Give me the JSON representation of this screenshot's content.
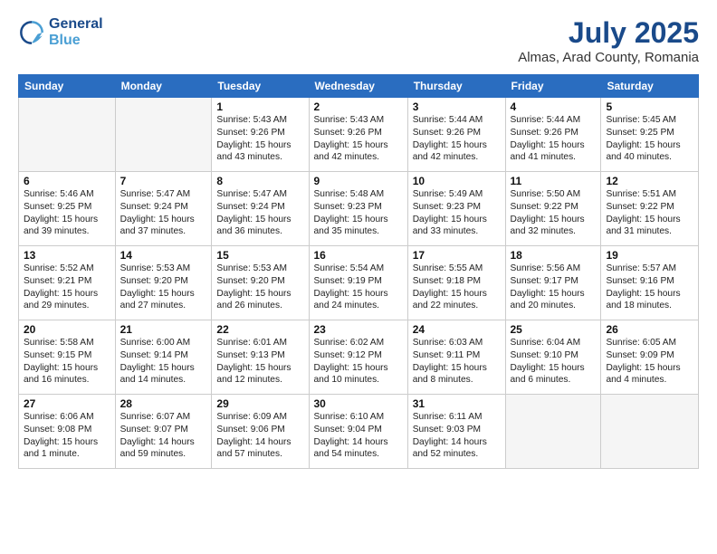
{
  "logo": {
    "line1": "General",
    "line2": "Blue"
  },
  "title": "July 2025",
  "subtitle": "Almas, Arad County, Romania",
  "days_header": [
    "Sunday",
    "Monday",
    "Tuesday",
    "Wednesday",
    "Thursday",
    "Friday",
    "Saturday"
  ],
  "weeks": [
    [
      {
        "day": "",
        "info": ""
      },
      {
        "day": "",
        "info": ""
      },
      {
        "day": "1",
        "info": "Sunrise: 5:43 AM\nSunset: 9:26 PM\nDaylight: 15 hours\nand 43 minutes."
      },
      {
        "day": "2",
        "info": "Sunrise: 5:43 AM\nSunset: 9:26 PM\nDaylight: 15 hours\nand 42 minutes."
      },
      {
        "day": "3",
        "info": "Sunrise: 5:44 AM\nSunset: 9:26 PM\nDaylight: 15 hours\nand 42 minutes."
      },
      {
        "day": "4",
        "info": "Sunrise: 5:44 AM\nSunset: 9:26 PM\nDaylight: 15 hours\nand 41 minutes."
      },
      {
        "day": "5",
        "info": "Sunrise: 5:45 AM\nSunset: 9:25 PM\nDaylight: 15 hours\nand 40 minutes."
      }
    ],
    [
      {
        "day": "6",
        "info": "Sunrise: 5:46 AM\nSunset: 9:25 PM\nDaylight: 15 hours\nand 39 minutes."
      },
      {
        "day": "7",
        "info": "Sunrise: 5:47 AM\nSunset: 9:24 PM\nDaylight: 15 hours\nand 37 minutes."
      },
      {
        "day": "8",
        "info": "Sunrise: 5:47 AM\nSunset: 9:24 PM\nDaylight: 15 hours\nand 36 minutes."
      },
      {
        "day": "9",
        "info": "Sunrise: 5:48 AM\nSunset: 9:23 PM\nDaylight: 15 hours\nand 35 minutes."
      },
      {
        "day": "10",
        "info": "Sunrise: 5:49 AM\nSunset: 9:23 PM\nDaylight: 15 hours\nand 33 minutes."
      },
      {
        "day": "11",
        "info": "Sunrise: 5:50 AM\nSunset: 9:22 PM\nDaylight: 15 hours\nand 32 minutes."
      },
      {
        "day": "12",
        "info": "Sunrise: 5:51 AM\nSunset: 9:22 PM\nDaylight: 15 hours\nand 31 minutes."
      }
    ],
    [
      {
        "day": "13",
        "info": "Sunrise: 5:52 AM\nSunset: 9:21 PM\nDaylight: 15 hours\nand 29 minutes."
      },
      {
        "day": "14",
        "info": "Sunrise: 5:53 AM\nSunset: 9:20 PM\nDaylight: 15 hours\nand 27 minutes."
      },
      {
        "day": "15",
        "info": "Sunrise: 5:53 AM\nSunset: 9:20 PM\nDaylight: 15 hours\nand 26 minutes."
      },
      {
        "day": "16",
        "info": "Sunrise: 5:54 AM\nSunset: 9:19 PM\nDaylight: 15 hours\nand 24 minutes."
      },
      {
        "day": "17",
        "info": "Sunrise: 5:55 AM\nSunset: 9:18 PM\nDaylight: 15 hours\nand 22 minutes."
      },
      {
        "day": "18",
        "info": "Sunrise: 5:56 AM\nSunset: 9:17 PM\nDaylight: 15 hours\nand 20 minutes."
      },
      {
        "day": "19",
        "info": "Sunrise: 5:57 AM\nSunset: 9:16 PM\nDaylight: 15 hours\nand 18 minutes."
      }
    ],
    [
      {
        "day": "20",
        "info": "Sunrise: 5:58 AM\nSunset: 9:15 PM\nDaylight: 15 hours\nand 16 minutes."
      },
      {
        "day": "21",
        "info": "Sunrise: 6:00 AM\nSunset: 9:14 PM\nDaylight: 15 hours\nand 14 minutes."
      },
      {
        "day": "22",
        "info": "Sunrise: 6:01 AM\nSunset: 9:13 PM\nDaylight: 15 hours\nand 12 minutes."
      },
      {
        "day": "23",
        "info": "Sunrise: 6:02 AM\nSunset: 9:12 PM\nDaylight: 15 hours\nand 10 minutes."
      },
      {
        "day": "24",
        "info": "Sunrise: 6:03 AM\nSunset: 9:11 PM\nDaylight: 15 hours\nand 8 minutes."
      },
      {
        "day": "25",
        "info": "Sunrise: 6:04 AM\nSunset: 9:10 PM\nDaylight: 15 hours\nand 6 minutes."
      },
      {
        "day": "26",
        "info": "Sunrise: 6:05 AM\nSunset: 9:09 PM\nDaylight: 15 hours\nand 4 minutes."
      }
    ],
    [
      {
        "day": "27",
        "info": "Sunrise: 6:06 AM\nSunset: 9:08 PM\nDaylight: 15 hours\nand 1 minute."
      },
      {
        "day": "28",
        "info": "Sunrise: 6:07 AM\nSunset: 9:07 PM\nDaylight: 14 hours\nand 59 minutes."
      },
      {
        "day": "29",
        "info": "Sunrise: 6:09 AM\nSunset: 9:06 PM\nDaylight: 14 hours\nand 57 minutes."
      },
      {
        "day": "30",
        "info": "Sunrise: 6:10 AM\nSunset: 9:04 PM\nDaylight: 14 hours\nand 54 minutes."
      },
      {
        "day": "31",
        "info": "Sunrise: 6:11 AM\nSunset: 9:03 PM\nDaylight: 14 hours\nand 52 minutes."
      },
      {
        "day": "",
        "info": ""
      },
      {
        "day": "",
        "info": ""
      }
    ]
  ]
}
